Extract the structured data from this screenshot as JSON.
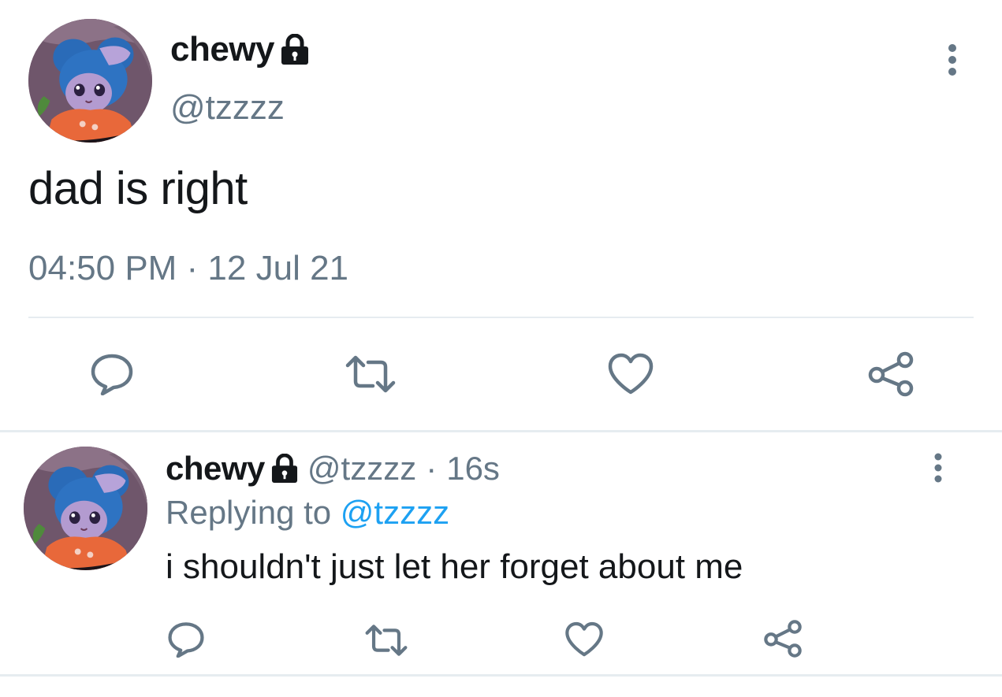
{
  "main_tweet": {
    "display_name": "chewy",
    "handle": "@tzzzz",
    "text": "dad is right",
    "timestamp": "04:50 PM · 12 Jul 21",
    "actions": [
      "reply-icon",
      "retweet-icon",
      "like-icon",
      "share-icon"
    ]
  },
  "reply_tweet": {
    "display_name": "chewy",
    "handle": "@tzzzz",
    "separator": "·",
    "time": "16s",
    "replying_prefix": "Replying to",
    "replying_to": "@tzzzz",
    "text": "i shouldn't just let her forget about me",
    "actions": [
      "reply-icon",
      "retweet-icon",
      "like-icon",
      "share-icon"
    ]
  },
  "colors": {
    "text_primary": "#14171a",
    "text_secondary": "#657786",
    "link": "#1da1f2",
    "divider": "#e6ecf0",
    "icon": "#657786"
  }
}
